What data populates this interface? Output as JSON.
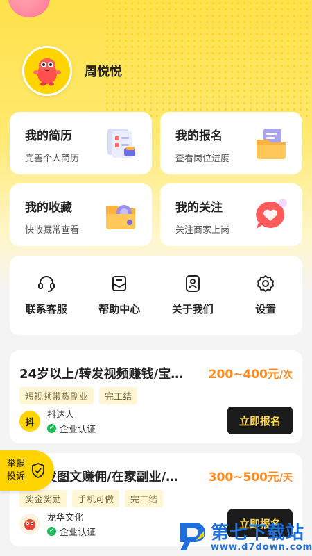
{
  "user": {
    "name": "周悦悦"
  },
  "quick_cards": [
    {
      "title": "我的简历",
      "subtitle": "完善个人简历"
    },
    {
      "title": "我的报名",
      "subtitle": "查看岗位进度"
    },
    {
      "title": "我的收藏",
      "subtitle": "快收藏常查看"
    },
    {
      "title": "我的关注",
      "subtitle": "关注商家上岗"
    }
  ],
  "tools": [
    {
      "label": "联系客服",
      "icon": "headset-icon"
    },
    {
      "label": "帮助中心",
      "icon": "help-mail-icon"
    },
    {
      "label": "关于我们",
      "icon": "about-user-icon"
    },
    {
      "label": "设置",
      "icon": "gear-icon"
    }
  ],
  "jobs": [
    {
      "title": "24岁以上/转发视频赚钱/宝…",
      "salary": "200~400元",
      "unit": "/次",
      "tags": [
        "短视频带货副业",
        "完工结"
      ],
      "company": "抖达人",
      "company_logo_text": "抖",
      "cert": "企业认证",
      "apply": "立即报名"
    },
    {
      "title": "发图文赚佣/在家副业/…",
      "salary": "300~500元",
      "unit": "/天",
      "tags": [
        "奖金奖励",
        "手机可做",
        "完工结"
      ],
      "company": "龙华文化",
      "cert": "企业认证",
      "apply": "立即报名"
    }
  ],
  "report": {
    "label": "举报投诉"
  },
  "watermark": {
    "name": "第七下载站",
    "url": "www.d7down.com"
  },
  "colors": {
    "brand_yellow": "#ffd400",
    "salary_orange": "#ff8a1f",
    "button_dark": "#1b1b1b",
    "cert_green": "#1fba5a",
    "watermark_blue": "#1e6fd9"
  }
}
